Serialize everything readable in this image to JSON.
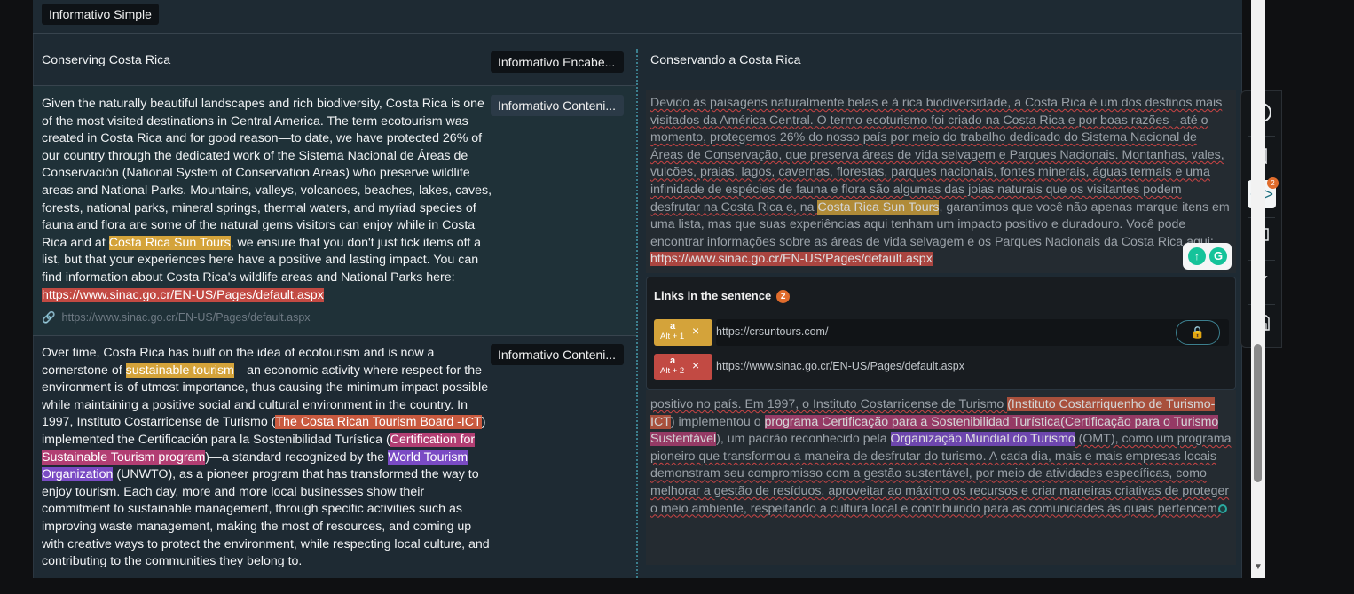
{
  "top": {
    "style_tag": "Informativo Simple"
  },
  "heading_row": {
    "source": "Conserving Costa Rica",
    "style_tag": "Informativo Encabe...",
    "target": "Conservando a Costa Rica"
  },
  "segment1": {
    "style_tag": "Informativo Conteni...",
    "source_parts": [
      "Given the naturally beautiful landscapes and rich biodiversity, Costa Rica is one of the most visited destinations in Central America. The term ecotourism was created in Costa Rica and for good reason—to date, we have protected 26% of our country through the dedicated work of the Sistema Nacional de Áreas de Conservación (National System of Conservation Areas) who preserve wildlife areas and National Parks. Mountains, valleys, volcanoes, beaches, lakes, caves, forests, national parks, mineral springs, thermal waters, and myriad species of fauna and flora are some of the natural gems visitors can enjoy while in Costa Rica and at ",
      "Costa Rica Sun Tours",
      ", we ensure that you don't just tick items off a list, but that your experiences here have a positive and lasting impact. You can find information about Costa Rica's wildlife areas and National Parks here: ",
      "https://www.sinac.go.cr/EN-US/Pages/default.aspx"
    ],
    "link_hint": "https://www.sinac.go.cr/EN-US/Pages/default.aspx",
    "target_parts": [
      "Devido às paisagens naturalmente belas e à rica biodiversidade, a Costa Rica é um dos destinos mais visitados da América Central. O termo ecoturismo foi criado na Costa Rica e por boas razões - até o momento, protegemos 26% do nosso país por meio do trabalho dedicado do Sistema Nacional de Áreas de Conservação, que preserva áreas de vida selvagem e Parques Nacionais. Montanhas, vales, vulcões, praias, lagos, cavernas, florestas, parques nacionais, fontes minerais, águas termais e uma infinidade de espécies de fauna e flora são algumas das joias naturais que os visitantes podem desfrutar na Costa Rica e, na ",
      "Costa Rica Sun Tours",
      ", garantimos que você não apenas marque itens em uma lista, mas que suas experiências aqui tenham um impacto positivo e duradouro. Você pode encontrar informações sobre as áreas de vida selvagem e os Parques Nacionais da Costa Rica aqui: ",
      "https://www.sinac.go.cr/EN-US/Pages/default.aspx"
    ]
  },
  "segment2": {
    "style_tag": "Informativo Conteni...",
    "source_parts": [
      "Over time, Costa Rica has built on the idea of ecotourism and is now a cornerstone of ",
      "sustainable tourism",
      "—an economic activity where respect for the environment is of utmost importance, thus causing the minimum impact possible while maintaining a positive social and cultural environment in the country. In 1997, Instituto Costarricense de Turismo (",
      "The Costa Rican Tourism Board -ICT",
      ") implemented the Certificación para la Sostenibilidad Turística (",
      "Certification for Sustainable Tourism program",
      ")—a standard recognized by the ",
      "World Tourism Organization",
      " (UNWTO), as a pioneer program that has transformed the way to enjoy tourism. Each day, more and more local businesses show their commitment to sustainable management, through specific activities such as improving waste management, making the most of resources, and coming up with creative ways to protect the environment, while respecting local culture, and contributing to the communities they belong to."
    ],
    "target_parts": [
      "positivo no país. Em 1997, o Instituto Costarricense de Turismo ",
      "(Instituto Costarriquenho de Turismo-ICT",
      ") implementou o ",
      "programa Certificação para a Sostenibilidad Turística(Certificação para o Turismo Sustentável",
      "), um padrão reconhecido pela ",
      "Organização Mundial do Turismo",
      " (OMT), como um programa pioneiro que transformou a maneira de desfrutar do turismo. A cada dia, mais e mais empresas locais demonstram seu compromisso com a gestão sustentável, por meio de atividades específicas, como melhorar a gestão de resíduos, aproveitar ao máximo os recursos e criar maneiras criativas de proteger o meio ambiente, respeitando a cultura local e contribuindo para as comunidades às quais pertencem."
    ]
  },
  "links_panel": {
    "title": "Links in the sentence",
    "count": "2",
    "links": [
      {
        "tag": "a",
        "shortcut": "Alt + 1",
        "url": "https://crsuntours.com/",
        "color": "#d4a33a"
      },
      {
        "tag": "a",
        "shortcut": "Alt + 2",
        "url": "https://www.sinac.go.cr/EN-US/Pages/default.aspx",
        "color": "#c24a43"
      }
    ]
  },
  "toolbar": {
    "close_icon": "close-circle-icon",
    "tags_badge": "2",
    "icons": [
      "bookmark-icon",
      "code-tags-icon",
      "copy-icon",
      "lightning-icon",
      "save-icon"
    ]
  },
  "grammarly": {
    "icons": [
      "grammarly-suggest-icon",
      "grammarly-logo-icon"
    ]
  }
}
